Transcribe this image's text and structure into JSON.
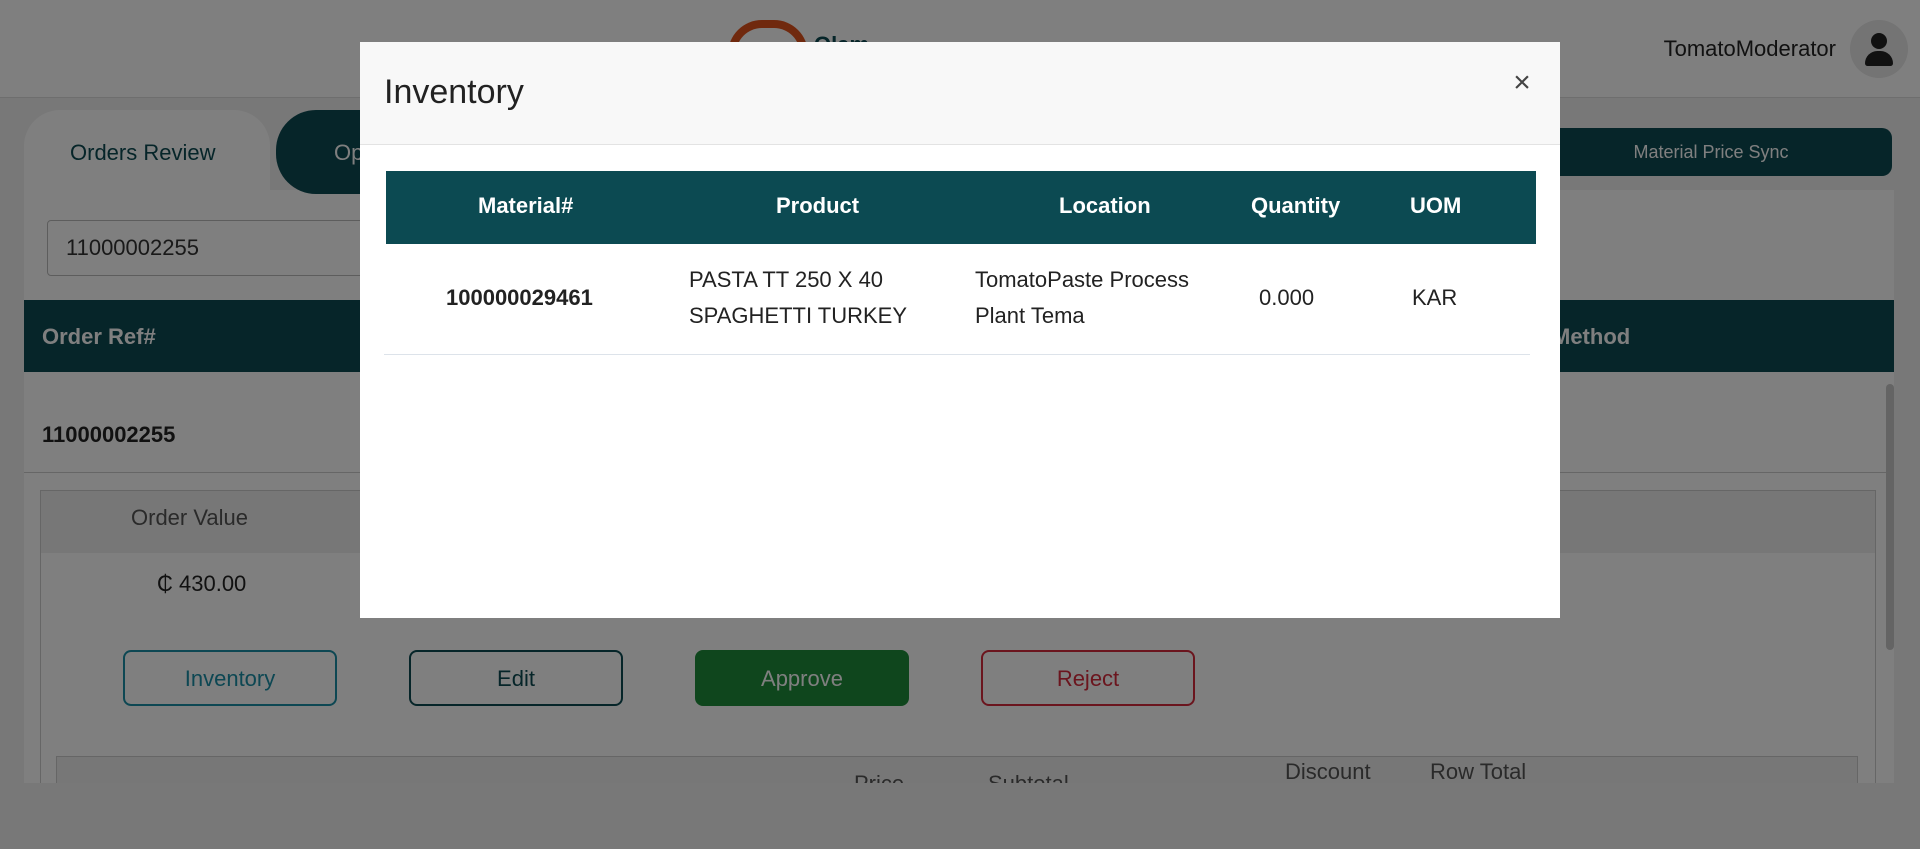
{
  "header": {
    "logo_text": "Olam",
    "username": "TomatoModerator"
  },
  "tabs": {
    "orders_review": "Orders Review",
    "second_tab": "Op",
    "material_price_sync": "Material Price Sync"
  },
  "search": {
    "value": "11000002255"
  },
  "orders_table": {
    "col_order_ref": "Order Ref#",
    "col_method": "Method",
    "row_order_ref": "11000002255"
  },
  "order_detail": {
    "order_value_label": "Order Value",
    "order_value": "₵ 430.00",
    "buttons": {
      "inventory": "Inventory",
      "edit": "Edit",
      "approve": "Approve",
      "reject": "Reject"
    },
    "items_headers": {
      "price": "Price",
      "subtotal": "Subtotal",
      "dash": "–",
      "discount": "Discount",
      "row_total": "Row Total"
    }
  },
  "modal": {
    "title": "Inventory",
    "close": "×",
    "columns": {
      "material": "Material#",
      "product": "Product",
      "location": "Location",
      "quantity": "Quantity",
      "uom": "UOM"
    },
    "rows": [
      {
        "material": "100000029461",
        "product_line1": "PASTA TT 250 X 40",
        "product_line2": "SPAGHETTI TURKEY",
        "location_line1": "TomatoPaste Process",
        "location_line2": "Plant Tema",
        "quantity": "0.000",
        "uom": "KAR"
      }
    ]
  },
  "colors": {
    "primary": "#0c4a52",
    "accent_orange": "#e0531c",
    "approve_green": "#1e8c3a",
    "reject_red": "#d62b3c",
    "inventory_teal": "#1b8fa6"
  }
}
